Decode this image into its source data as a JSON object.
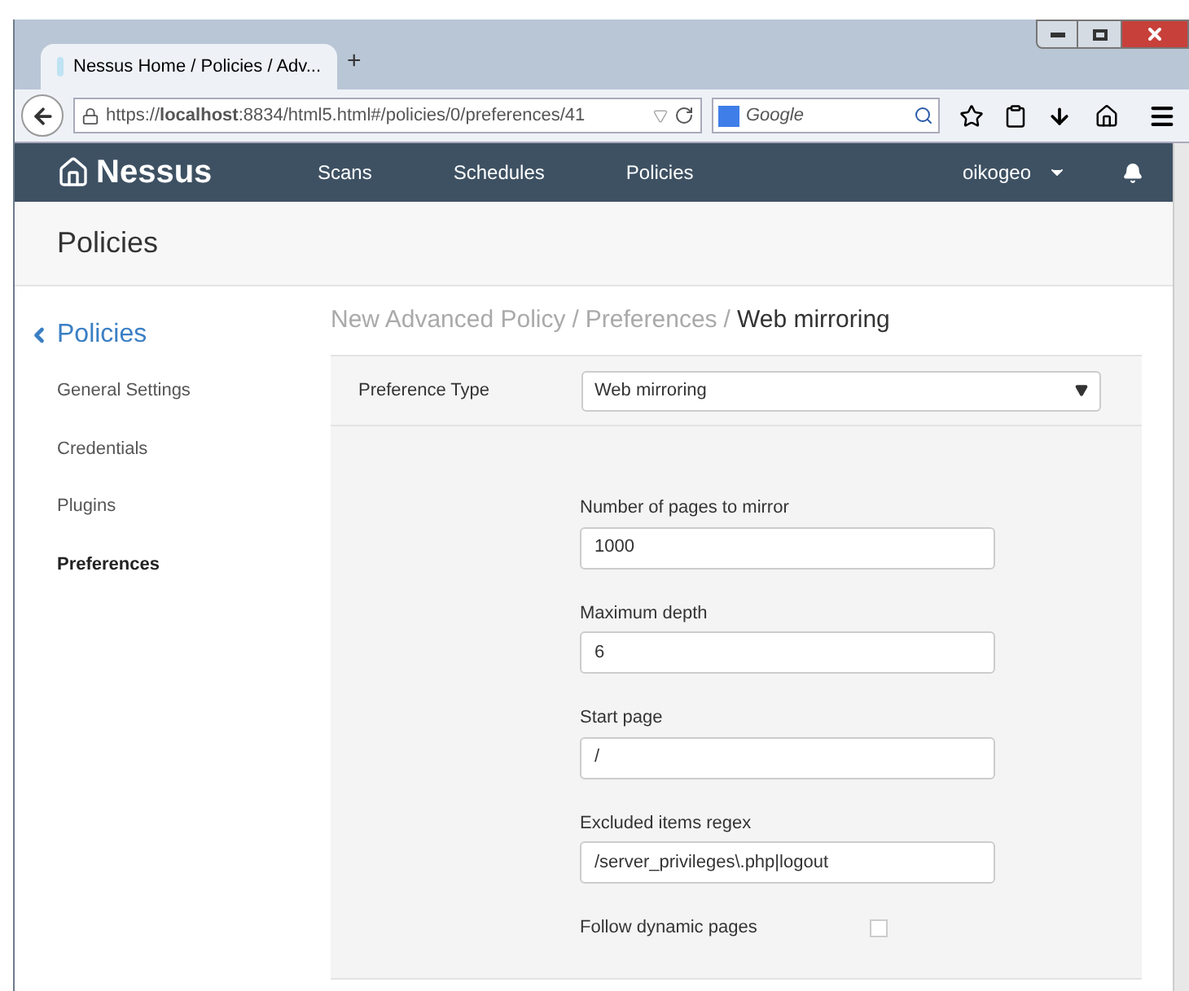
{
  "browser": {
    "tab_title": "Nessus Home / Policies / Adv...",
    "new_tab": "+",
    "url": "https://**localhost**:8834/html5.html#/policies/0/preferences/41",
    "search_placeholder": "Google"
  },
  "nav": {
    "logo": "Nessus",
    "items": [
      {
        "label": "Scans"
      },
      {
        "label": "Schedules"
      },
      {
        "label": "Policies"
      }
    ],
    "user": "oikogeo"
  },
  "page_title": "Policies",
  "sidebar": {
    "back": "Policies",
    "items": [
      {
        "label": "General Settings",
        "selected": false
      },
      {
        "label": "Credentials",
        "selected": false
      },
      {
        "label": "Plugins",
        "selected": false
      },
      {
        "label": "Preferences",
        "selected": true
      }
    ]
  },
  "breadcrumb": [
    {
      "text": "New Advanced Policy",
      "current": false
    },
    {
      "text": "/",
      "current": false
    },
    {
      "text": "Preferences",
      "current": false
    },
    {
      "text": "/",
      "current": false
    },
    {
      "text": "Web mirroring",
      "current": true
    }
  ],
  "preference_type": {
    "label": "Preference Type",
    "value": "Web mirroring"
  },
  "fields": [
    {
      "kind": "text",
      "label": "Number of pages to mirror",
      "value": "1000"
    },
    {
      "kind": "text",
      "label": "Maximum depth",
      "value": "6"
    },
    {
      "kind": "text",
      "label": "Start page",
      "value": "/"
    },
    {
      "kind": "text",
      "label": "Excluded items regex",
      "value": "/server_privileges\\.php|logout"
    },
    {
      "kind": "checkbox",
      "label": "Follow dynamic pages",
      "checked": false
    }
  ]
}
